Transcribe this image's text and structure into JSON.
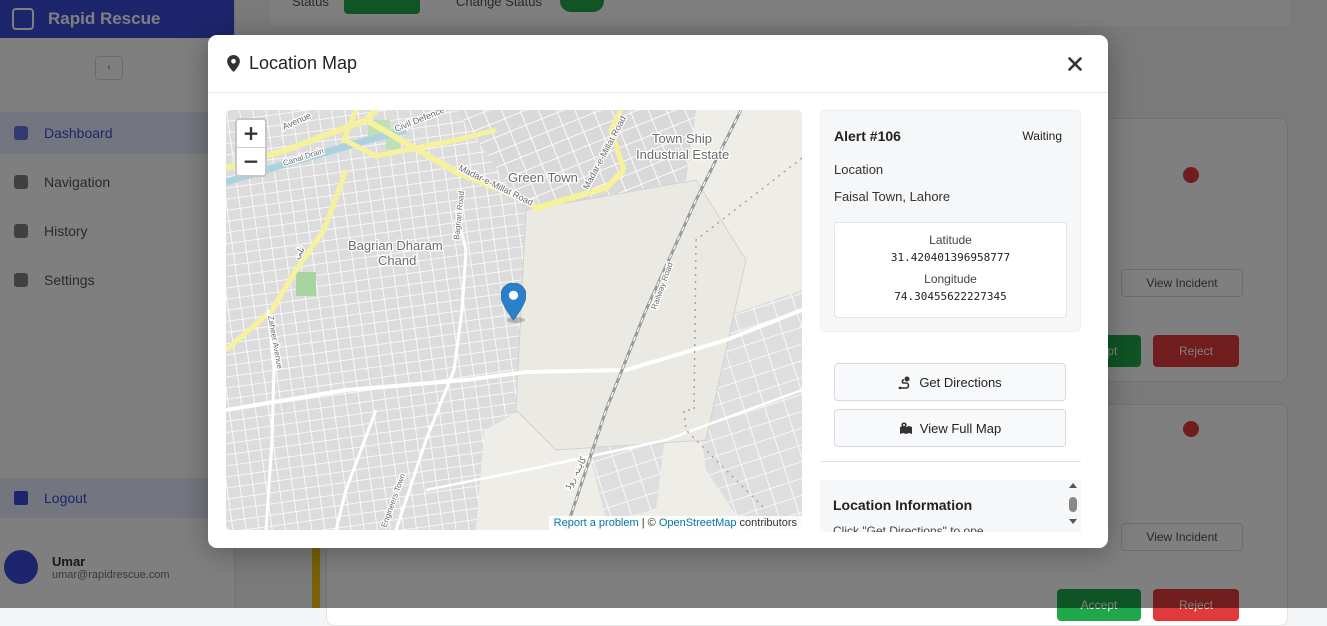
{
  "app": {
    "brand": "Rapid Rescue",
    "collapse_glyph": "‹"
  },
  "sidebar": {
    "items": [
      {
        "label": "Dashboard",
        "active": true
      },
      {
        "label": "Navigation",
        "active": false
      },
      {
        "label": "History",
        "active": false
      },
      {
        "label": "Settings",
        "active": false
      }
    ],
    "logout_label": "Logout",
    "user_name": "Umar",
    "user_email": "umar@rapidrescue.com"
  },
  "background": {
    "status_label": "Status",
    "change_status_label": "Change Status",
    "view_incident_label": "View Incident",
    "accept_label": "Accept",
    "reject_label": "Reject"
  },
  "modal": {
    "title": "Location Map",
    "close_glyph": "✕"
  },
  "map": {
    "zoom_in": "+",
    "zoom_out": "−",
    "attribution_link1": "Report a problem",
    "attribution_sep": " | © ",
    "attribution_link2": "OpenStreetMap",
    "attribution_suffix": " contributors",
    "labels": {
      "town_ship": "Town Ship",
      "industrial_estate": "Industrial Estate",
      "green_town": "Green Town",
      "bagrian_1": "Bagrian Dharam",
      "bagrian_2": "Chand",
      "madar_road": "Madar-e-Millat Road",
      "madar_road_2": "Madar-e-Millat Road",
      "civil_defence": "Civil Defence",
      "avenue": "Avenue",
      "zaheer_avenue": "Zaheer Avenue",
      "bagrian_road": "Bagrian Road",
      "railway_road": "Railway Road",
      "engineers_town": "Engineers Town",
      "canal_drain": "Canal Drain",
      "tali": "تلی",
      "urdu_road": "کاہنہ روڈ"
    }
  },
  "alert": {
    "id_label": "Alert #106",
    "status": "Waiting",
    "location_label": "Location",
    "location_value": "Faisal Town, Lahore",
    "latitude_label": "Latitude",
    "latitude_value": "31.420401396958777",
    "longitude_label": "Longitude",
    "longitude_value": "74.30455622227345"
  },
  "actions": {
    "get_directions": "Get Directions",
    "view_full_map": "View Full Map"
  },
  "location_info": {
    "title": "Location Information",
    "text": "Click \"Get Directions\" to ope"
  },
  "colors": {
    "brand": "#3b4bd8",
    "success": "#22a84a",
    "danger": "#e23a3a",
    "marker": "#2a81cb",
    "link": "#0078a8"
  },
  "icons": {
    "modal_title": "map-pin-icon",
    "close": "close-icon",
    "directions": "directions-icon",
    "full_map": "map-icon",
    "marker": "map-marker-icon"
  }
}
